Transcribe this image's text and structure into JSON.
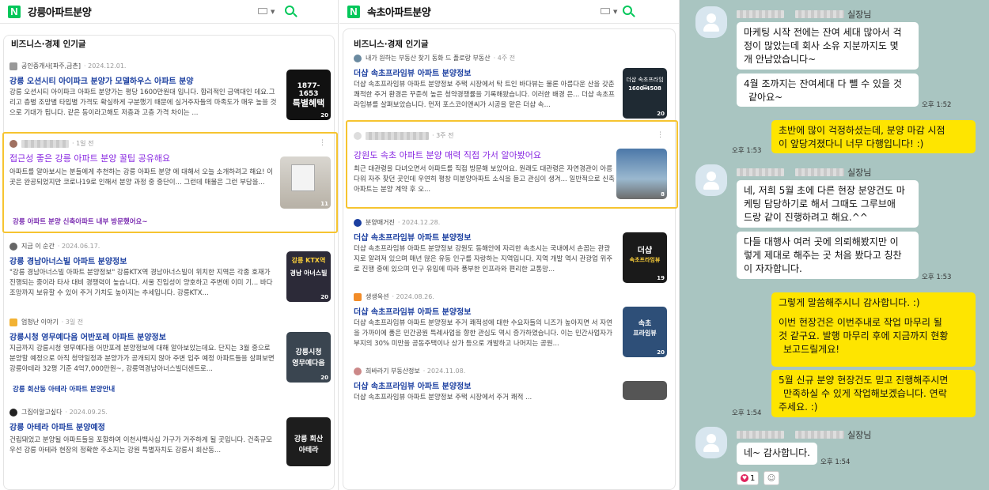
{
  "left_panel": {
    "query": "강릉아파트분양",
    "section_title": "비즈니스·경제 인기글",
    "items": [
      {
        "source": "공인중개사[파주,금촌]",
        "date": "· 2024.12.01.",
        "title": "강릉 오션시티 아이파크 분양가 모델하우스 아파트 분양",
        "desc": "강릉 오션시티 아이파크 아파트 분양가는 평당 1600만원대 입니다. 합리적인 금액대인 데요.그리고 층별 조망별 타입별 가격도 확실하게 구분했기 때문에 실거주자들의 마족도가 매우 높을 것으로 기대가 됩니다. 같은 동이라고해도 저층과 고층 가격 차이는 ...",
        "thumb_text": "1877-1653",
        "thumb_text2": "특별혜택",
        "count": "20"
      },
      {
        "source": "",
        "date": "· 1일 전",
        "title": "접근성 좋은 강릉 아파트 분양 꿀팁 공유해요",
        "desc": "아파트를 알아보시는 분들에게 추천하는 강릉 아파트 분양 에 대해서 오늘 소개하려고 해요! 이곳은 완공되었지만 코로나19로 인해서 분양 과정 중 중단이... 그런데 매물은 그런 부담을...",
        "count": "11",
        "sub": "강릉 아파트 분양 신축아파트 내부 방문했어요~"
      },
      {
        "source": "지금 이 순간",
        "date": "· 2024.06.17.",
        "title": "강릉 경남아너스빌 아파트 분양정보",
        "desc": "\"강릉 경남아너스빌 아파트 분양정보\" 강릉KTX역 경남아너스빌이 위치한 지역은 각종 호재가 진행되는 중이라 타사 대비 경쟁력이 높습니다. 서울 진입성이 양호하고 주변에 이미 기... 바다 조망까지 보유할 수 있어 주거 가치도 높아지는 추세입니다. 강릉KTX...",
        "thumb_text": "강릉 KTX역",
        "thumb_text2": "경남 아너스빌",
        "count": "20"
      },
      {
        "source": "엄청난 이야기",
        "date": "· 3일 전",
        "title": "강릉시청 영무예다음 어반포레 아파트 분양정보",
        "desc": "지금까지 강릉시청 영무예다음 어반포레 분양정보에 대해 알아보았는데요. 단지는 3월 중으로 분양할 예정으로 아직 청약일정과 분양가가 공개되지 않아 주변 입주 예정 아파트들을 살펴보면 강릉아테라 32평 기준 4억7,000만원~, 강릉역경남아너스빌더센트로...",
        "thumb_text": "강릉시청",
        "thumb_text2": "영무예다음",
        "count": "20",
        "sub": "강릉 회산동 아테라 아파트 분양안내"
      },
      {
        "source": "그집이알고싶다",
        "date": "· 2024.09.25.",
        "title": "강릉 아테라 아파트 분양예정",
        "desc": "건립돼었고 분양될 아파트들을 포함하여 이천사백사십 가구가 거주하게 될 곳입니다. 건축규모 우선 강릉 아테라 현장의 정확한 주소지는 강원 특별자치도 강릉시 회산동...",
        "thumb_text": "강릉 회산",
        "thumb_text2": "아테라"
      }
    ]
  },
  "middle_panel": {
    "query": "속초아파트분양",
    "section_title": "비즈니스·경제 인기글",
    "items": [
      {
        "source": "내가 원하는 부동산 찾기 동화 드 플로랑 부동산",
        "date": "· 4주 전",
        "title": "더샵 속초프라임뷰 아파트 분양정보",
        "desc": "더샵 속초프라임뷰 아파트 분양정보 주택 시장에서 탁 트인 바다뷰는 물론 아름다운 산을 갖춘 쾌적한 주거 환경은 꾸준히 높은 청약경쟁률을 기록해왔습니다. 이러한 배경 은... 더샵 속초프라임뷰를 살펴보았습니다. 먼저 포스코이앤씨가 시공을 맡은 더샵 속...",
        "thumb_text": "더샵 속초프라임뷰",
        "thumb_text2": "1600-4508",
        "count": "20"
      },
      {
        "source": "",
        "date": "· 3주 전",
        "title": "강원도 속초 아파트 분양 매력 직접 가서 알아봤어요",
        "desc": "최근 대관령을 다녀오면서 아파트를 직접 방문해 보았어요. 원래도 대관령은 자연경관이 아름다워 자주 찾던 곳인데 우연히 평창 미분양아파트 소식을 듣고 관심이 생겨... 일반적으로 신축 아파트는 분양 계약 후 오...",
        "count": "8"
      },
      {
        "source": "분양매거진",
        "date": "· 2024.12.28.",
        "title": "더샵 속초프라임뷰 아파트 분양정보",
        "desc": "더샵 속초프라임뷰 아파트 분양정보 강원도 동해안에 자리한 속초시는 국내에서 손꼽는 관광지로 알려져 있으며 매년 많은 유동 인구를 자랑하는 지역입니다. 지역 개발 역시 관광업 위주로 진행 중에 있으며 인구 유입에 따라 풍부한 인프라와 편리한 교통망...",
        "thumb_text": "더샵",
        "thumb_text2": "속초프라임뷰",
        "count": "19"
      },
      {
        "source": "생생옥션",
        "date": "· 2024.08.26.",
        "title": "더샵 속초프라임뷰 아파트 분양정보",
        "desc": "더샵 속초프라임뷰 아파트 분양정보 주거 쾌적성에 대한 수요자들의 니즈가 높아지면 서 자연을 가까이에 품은 민간공원 특례사업을 향한 관심도 역시 증가하였습니다. 이는 민간사업자가 부지의 30% 미만을 공동주택이나 상가 등으로 개발하고 나머지는 공원...",
        "thumb_text": "속초",
        "thumb_text2": "프라임뷰",
        "count": "20"
      },
      {
        "source": "희바라기 부동산정보",
        "date": "· 2024.11.08.",
        "title": "더샵 속초프라임뷰 아파트 분양정보",
        "desc": "더샵 속초프라임뷰 아파트 분양정보 주택 시장에서 주거 쾌적 ..."
      }
    ]
  },
  "chat": {
    "messages": [
      {
        "sender": "실장님",
        "lines": [
          "마케팅 시작 전에는 잔여 세대 많아서 걱",
          "정이 많았는데 회사 소유 지분까지도 몇",
          "개 안남았습니다~"
        ]
      },
      {
        "lines": [
          "4월 조까지는 잔여세대 다 뺄 수 있을 것",
          "같아요~"
        ],
        "time": "오후 1:52"
      },
      {
        "lines": [
          "초반에 많이 걱정하셨는데, 분양 마감 시점",
          "이 앞당겨졌다니 너무 다행입니다! :)"
        ],
        "time": "오후 1:53"
      },
      {
        "sender": "실장님",
        "lines": [
          "네, 저희 5월 초에 다른 현장 분양건도 마",
          "케팅 담당하기로 해서 그때도 그루브애",
          "드랑 같이 진행하려고 해요.^^"
        ]
      },
      {
        "lines": [
          "다들 대행사 여러 곳에 의뢰해봤지만 이",
          "렇게 제대로 해주는 곳 처음 봤다고 칭찬",
          "이 자자합니다."
        ],
        "time": "오후 1:53"
      },
      {
        "lines": [
          "그렇게 말씀해주시니 감사합니다. :)",
          "",
          "이번 현장건은 이번주내로 작업 마무리 될",
          "것 같구요. 발행 마무리 후에 지금까지 현황",
          "보고드릴게요!"
        ]
      },
      {
        "lines": [
          "5월 신규 분양 현장건도 믿고 진행해주시면",
          "만족하실 수 있게 작업해보겠습니다. 연락",
          "주세요. :)"
        ],
        "time": "오후 1:54"
      },
      {
        "sender": "실장님",
        "lines": [
          "네~ 감사합니다."
        ],
        "time": "오후 1:54"
      }
    ],
    "reaction_count": "1"
  }
}
